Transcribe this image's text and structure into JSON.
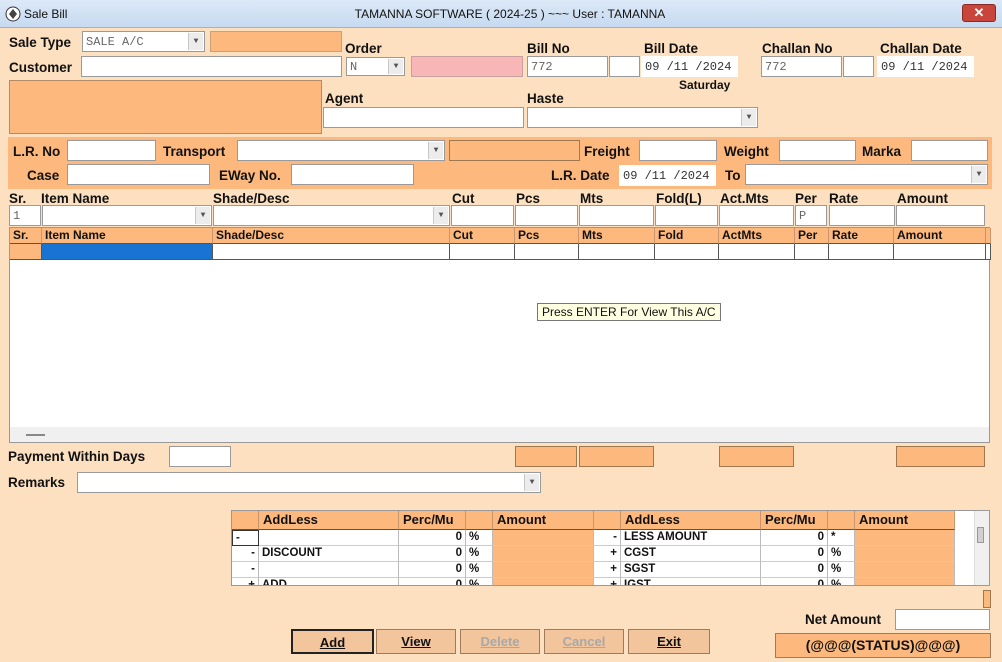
{
  "window": {
    "name": "Sale Bill",
    "title": "TAMANNA SOFTWARE   ( 2024-25 )  ~~~ User : TAMANNA",
    "close": "✕"
  },
  "form": {
    "sale_type_label": "Sale Type",
    "sale_type_value": "SALE A/C",
    "customer_label": "Customer",
    "order_label": "Order",
    "order_value": "N",
    "bill_no_label": "Bill No",
    "bill_no_value": "772",
    "bill_date_label": "Bill Date",
    "bill_date_value": "09 /11 /2024",
    "bill_day": "Saturday",
    "challan_no_label": "Challan No",
    "challan_no_value": "772",
    "challan_date_label": "Challan Date",
    "challan_date_value": "09 /11 /2024",
    "agent_label": "Agent",
    "haste_label": "Haste",
    "lr_no_label": "L.R. No",
    "transport_label": "Transport",
    "freight_label": "Freight",
    "weight_label": "Weight",
    "marka_label": "Marka",
    "case_label": "Case",
    "eway_label": "EWay No.",
    "lr_date_label": "L.R. Date",
    "lr_date_value": "09 /11 /2024",
    "to_label": "To"
  },
  "entry": {
    "labels": [
      "Sr.",
      "Item Name",
      "Shade/Desc",
      "Cut",
      "Pcs",
      "Mts",
      "Fold(L)",
      "Act.Mts",
      "Per",
      "Rate",
      "Amount"
    ],
    "sr_value": "1",
    "per_value": "P"
  },
  "grid": {
    "headers": [
      "Sr.",
      "Item Name",
      "Shade/Desc",
      "Cut",
      "Pcs",
      "Mts",
      "Fold",
      "ActMts",
      "Per",
      "Rate",
      "Amount"
    ],
    "tooltip": "Press ENTER For View This A/C"
  },
  "footer": {
    "payment_label": "Payment Within Days",
    "remarks_label": "Remarks",
    "net_amount_label": "Net Amount"
  },
  "addless": {
    "headers": [
      "AddLess",
      "Perc/Mu",
      "Amount",
      "AddLess",
      "Perc/Mu",
      "Amount"
    ],
    "left_rows": [
      {
        "sign": "-",
        "name": "",
        "perc": "0",
        "unit": "%"
      },
      {
        "sign": "-",
        "name": "DISCOUNT",
        "perc": "0",
        "unit": "%"
      },
      {
        "sign": "-",
        "name": "",
        "perc": "0",
        "unit": "%"
      },
      {
        "sign": "+",
        "name": "ADD",
        "perc": "0",
        "unit": "%"
      }
    ],
    "right_rows": [
      {
        "sign": "-",
        "name": "LESS AMOUNT",
        "perc": "0",
        "unit": "*"
      },
      {
        "sign": "+",
        "name": "CGST",
        "perc": "0",
        "unit": "%"
      },
      {
        "sign": "+",
        "name": "SGST",
        "perc": "0",
        "unit": "%"
      },
      {
        "sign": "+",
        "name": "IGST",
        "perc": "0",
        "unit": "%"
      }
    ]
  },
  "buttons": {
    "add": "Add",
    "view": "View",
    "delete": "Delete",
    "cancel": "Cancel",
    "exit": "Exit"
  },
  "status": "(@@@(STATUS)@@@)",
  "colors": {
    "panel": "#fdb97d",
    "background": "#fde0c0",
    "selected_cell": "#1874d2"
  }
}
